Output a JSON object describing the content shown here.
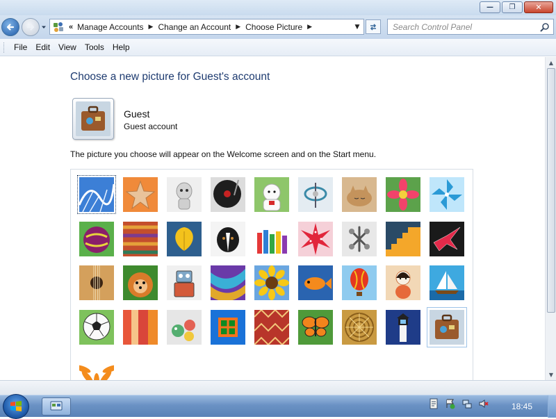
{
  "window": {
    "buttons": {
      "minimize": "minimize",
      "maximize": "restore",
      "close": "close"
    }
  },
  "address": {
    "crumbs": [
      "Manage Accounts",
      "Change an Account",
      "Choose Picture"
    ],
    "overflow": "«"
  },
  "search": {
    "placeholder": "Search Control Panel"
  },
  "menu": [
    "File",
    "Edit",
    "View",
    "Tools",
    "Help"
  ],
  "page": {
    "heading": "Choose a new picture for Guest's account",
    "account_name": "Guest",
    "account_type": "Guest account",
    "description": "The picture you choose will appear on the Welcome screen and on the Start menu."
  },
  "pictures": [
    "roller-coaster",
    "starfish",
    "robot-toy",
    "turntable",
    "lucky-cat",
    "gyroscope",
    "kitten",
    "pink-flower",
    "pinwheel",
    "bowling-ball",
    "fabric-weave",
    "yellow-leaf",
    "dog",
    "crayons",
    "red-star",
    "jacks",
    "stairs",
    "paper-crane",
    "guitar",
    "pomeranian",
    "tin-robot",
    "silk-scarf",
    "sunflower",
    "tropical-fish",
    "hot-air-balloon",
    "kokeshi-doll",
    "sailboat",
    "soccer-ball",
    "textiles",
    "marbles",
    "window",
    "rug-pattern",
    "butterfly",
    "basket",
    "lighthouse",
    "suitcase",
    "orange-daisy"
  ],
  "selected_picture": "roller-coaster",
  "current_picture": "suitcase",
  "taskbar": {
    "clock": "18:45"
  },
  "colors": {
    "heading": "#1e3b70",
    "taskbar": "#6b92c4"
  }
}
